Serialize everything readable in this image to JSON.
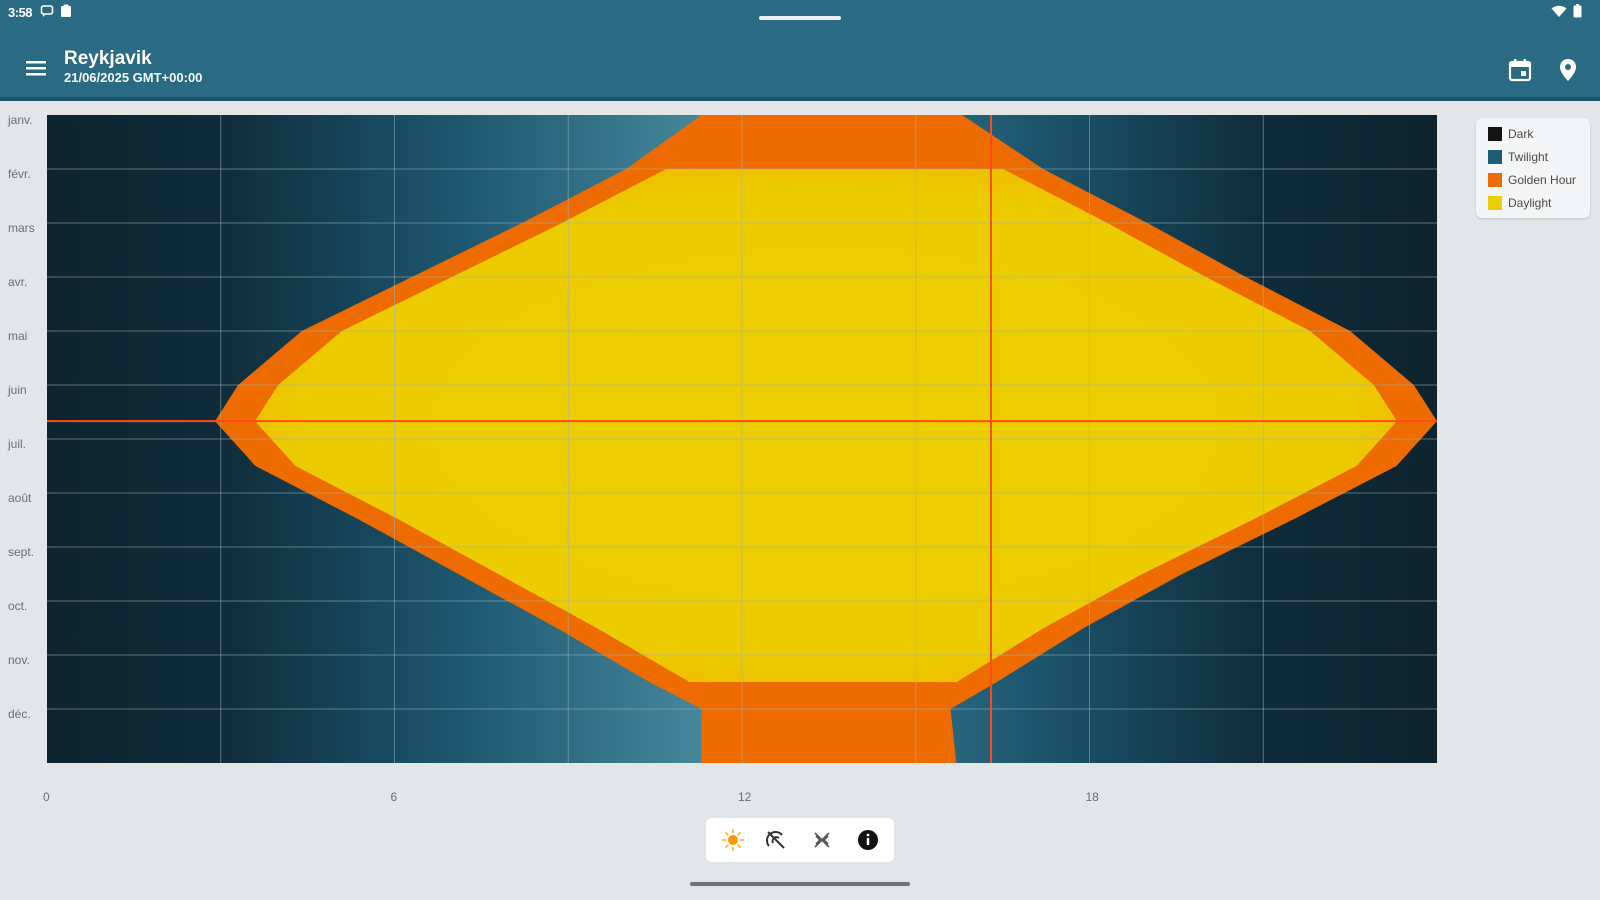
{
  "status_bar": {
    "time": "3:58"
  },
  "toolbar": {
    "title": "Reykjavik",
    "subtitle": "21/06/2025 GMT+00:00"
  },
  "colors": {
    "appbar": "#2a6a82",
    "dark": "#0d2430",
    "twilight": "#1e5d74",
    "golden_hour": "#ee6b00",
    "daylight": "#ecce00",
    "grid": "#9ab0b8",
    "current": "#ff4a1a"
  },
  "legend": {
    "items": [
      {
        "label": "Dark",
        "color": "#141414"
      },
      {
        "label": "Twilight",
        "color": "#1e5d74"
      },
      {
        "label": "Golden Hour",
        "color": "#ee6b00"
      },
      {
        "label": "Daylight",
        "color": "#ecce00"
      }
    ]
  },
  "chart_data": {
    "type": "heatmap",
    "x_ticks": [
      "0",
      "6",
      "12",
      "18"
    ],
    "y_ticks": [
      "janv.",
      "févr.",
      "mars",
      "avr.",
      "mai",
      "juin",
      "juil.",
      "août",
      "sept.",
      "oct.",
      "nov.",
      "déc."
    ],
    "xlim": [
      0,
      24
    ],
    "ylim_months": [
      0,
      12
    ],
    "current_time_hour": 16.3,
    "current_date_month": 5.67,
    "daylight_profile": [
      {
        "month": 0.0,
        "sunrise": 11.3,
        "sunset": 15.8
      },
      {
        "month": 1.0,
        "sunrise": 10.0,
        "sunset": 17.2
      },
      {
        "month": 2.0,
        "sunrise": 8.2,
        "sunset": 19.0
      },
      {
        "month": 3.0,
        "sunrise": 6.3,
        "sunset": 20.7
      },
      {
        "month": 4.0,
        "sunrise": 4.4,
        "sunset": 22.5
      },
      {
        "month": 5.0,
        "sunrise": 3.3,
        "sunset": 23.6
      },
      {
        "month": 5.67,
        "sunrise": 2.9,
        "sunset": 24.0
      },
      {
        "month": 6.5,
        "sunrise": 3.6,
        "sunset": 23.3
      },
      {
        "month": 7.5,
        "sunrise": 5.4,
        "sunset": 21.5
      },
      {
        "month": 8.5,
        "sunrise": 7.1,
        "sunset": 19.6
      },
      {
        "month": 9.5,
        "sunrise": 8.8,
        "sunset": 17.9
      },
      {
        "month": 10.5,
        "sunrise": 10.4,
        "sunset": 16.4
      },
      {
        "month": 11.0,
        "sunrise": 11.3,
        "sunset": 15.6
      },
      {
        "month": 12.0,
        "sunrise": 11.3,
        "sunset": 15.7
      }
    ]
  },
  "mode_bar": {
    "buttons": [
      {
        "name": "sun-icon"
      },
      {
        "name": "sun-off-icon"
      },
      {
        "name": "moon-off-icon"
      },
      {
        "name": "info-icon"
      }
    ]
  }
}
